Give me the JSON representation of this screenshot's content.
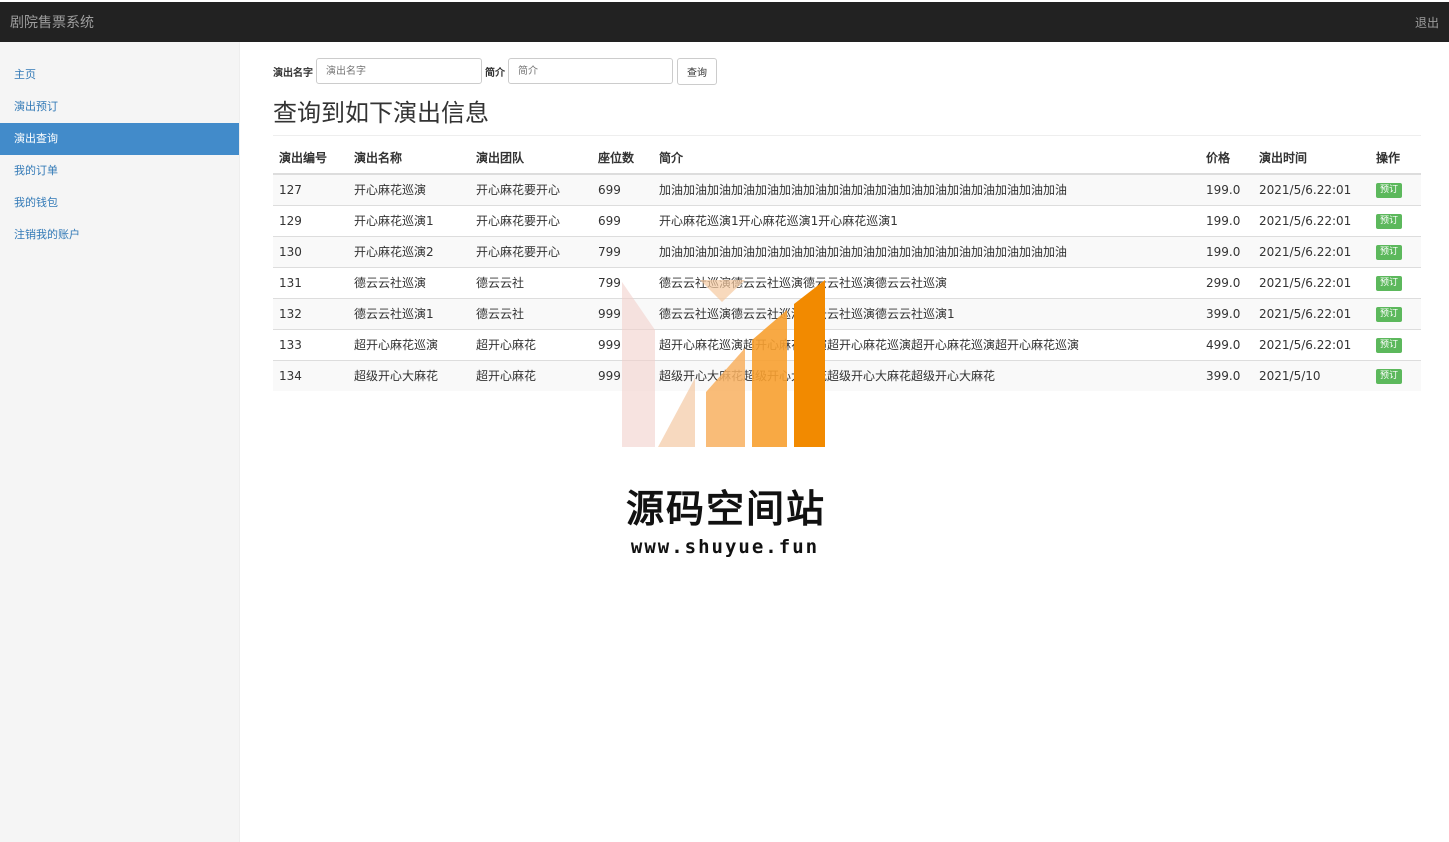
{
  "app": {
    "title": "剧院售票系统",
    "logout_label": "退出"
  },
  "sidebar": {
    "items": [
      {
        "label": "主页"
      },
      {
        "label": "演出预订"
      },
      {
        "label": "演出查询"
      },
      {
        "label": "我的订单"
      },
      {
        "label": "我的钱包"
      },
      {
        "label": "注销我的账户"
      }
    ],
    "active_index": 2
  },
  "search": {
    "name_label": "演出名字",
    "name_placeholder": "演出名字",
    "desc_label": "简介",
    "desc_placeholder": "简介",
    "submit_label": "查询"
  },
  "result_heading": "查询到如下演出信息",
  "table": {
    "headers": [
      "演出编号",
      "演出名称",
      "演出团队",
      "座位数",
      "简介",
      "价格",
      "演出时间",
      "操作"
    ],
    "action_label": "预订",
    "rows": [
      [
        "127",
        "开心麻花巡演",
        "开心麻花要开心",
        "699",
        "加油加油加油加油加油加油加油加油加油加油加油加油加油加油加油加油加油",
        "199.0",
        "2021/5/6.22:01"
      ],
      [
        "129",
        "开心麻花巡演1",
        "开心麻花要开心",
        "699",
        "开心麻花巡演1开心麻花巡演1开心麻花巡演1",
        "199.0",
        "2021/5/6.22:01"
      ],
      [
        "130",
        "开心麻花巡演2",
        "开心麻花要开心",
        "799",
        "加油加油加油加油加油加油加油加油加油加油加油加油加油加油加油加油加油",
        "199.0",
        "2021/5/6.22:01"
      ],
      [
        "131",
        "德云云社巡演",
        "德云云社",
        "799",
        "德云云社巡演德云云社巡演德云云社巡演德云云社巡演",
        "299.0",
        "2021/5/6.22:01"
      ],
      [
        "132",
        "德云云社巡演1",
        "德云云社",
        "999",
        "德云云社巡演德云云社巡演德云云社巡演德云云社巡演1",
        "399.0",
        "2021/5/6.22:01"
      ],
      [
        "133",
        "超开心麻花巡演",
        "超开心麻花",
        "999",
        "超开心麻花巡演超开心麻花巡演超开心麻花巡演超开心麻花巡演超开心麻花巡演",
        "499.0",
        "2021/5/6.22:01"
      ],
      [
        "134",
        "超级开心大麻花",
        "超开心麻花",
        "999",
        "超级开心大麻花超级开心大麻花超级开心大麻花超级开心大麻花",
        "399.0",
        "2021/5/10"
      ]
    ]
  },
  "watermark": {
    "title": "源码空间站",
    "url": "www.shuyue.fun"
  },
  "colors": {
    "navbar": "#222222",
    "accent": "#428bca",
    "link": "#337ab7",
    "success": "#5cb85c"
  }
}
